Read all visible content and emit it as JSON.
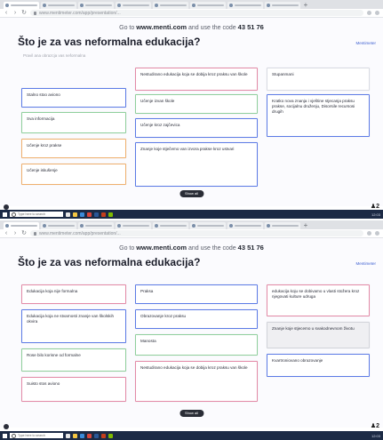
{
  "colors": {
    "accent_blue": "#5c7be6",
    "accent_pink": "#e38aa7",
    "accent_green": "#8fcf9c",
    "accent_orange": "#efb06e",
    "taskbar": "#1c2a45"
  },
  "top": {
    "banner_prefix": "Go to",
    "banner_url": "www.menti.com",
    "banner_middle": "and use the code",
    "banner_code": "43 51 76",
    "title": "Što je za vas neformalna edukacija?",
    "hint": "Pravil ana obrazcja vas neformalna",
    "results_link": "Mentimeter",
    "cards": {
      "c1": "Stalno stoo aviono",
      "c2": "Nestudirano edukacija koja se dobija kroz praksu van škole",
      "c3": "Stupanmani",
      "c4": "Sva informacija",
      "c5": "Učenje izvan škole",
      "c6": "Kratko nova znanja i vještine stjecanja praksu prakse, socijalnu druženju, Disorsile recursosi drugih",
      "c7": "Učenje kroz prakse",
      "c8": "Učenje kroz zajčevica",
      "c9": "Učenje iskušenje",
      "c10": "Znanje koje stječemo van izvora prakse kroz ustvari"
    },
    "show_all": "Show all",
    "participants": "2"
  },
  "bottom": {
    "banner_prefix": "Go to",
    "banner_url": "www.menti.com",
    "banner_middle": "and use the code",
    "banner_code": "43 51 76",
    "title": "Što je za vas neformalna edukacija?",
    "results_link": "Mentimeter",
    "cards": {
      "c1": "Edukacija koja nije formalna",
      "c2": "Praksa",
      "c3": "edukacija koju se dobivamo u vlasti stožera kroz njegovati kulture udruga",
      "c4": "Edukacija koja ne stvarnosti znanje van školskih okvira",
      "c5": "Obrazovanje kroz praksu",
      "c6": "Znanje koje stjecemo u svakodnevnom životu",
      "c7": "Rose bilo korisne od formalne",
      "c8": "Manosta",
      "c9": "Suisto stos aviono",
      "c10": "Nestudirano edukacija koja se dobija kroz praksu van škole",
      "c11": "Kvartroniovano obrazovanje"
    },
    "show_all": "Show all",
    "participants": "2"
  },
  "browser": {
    "tab_label": "Mentimeter",
    "url": "www.mentimeter.com/app/presentation/..."
  },
  "taskbar": {
    "search_placeholder": "Type here to search",
    "tray_time": "12:03"
  }
}
